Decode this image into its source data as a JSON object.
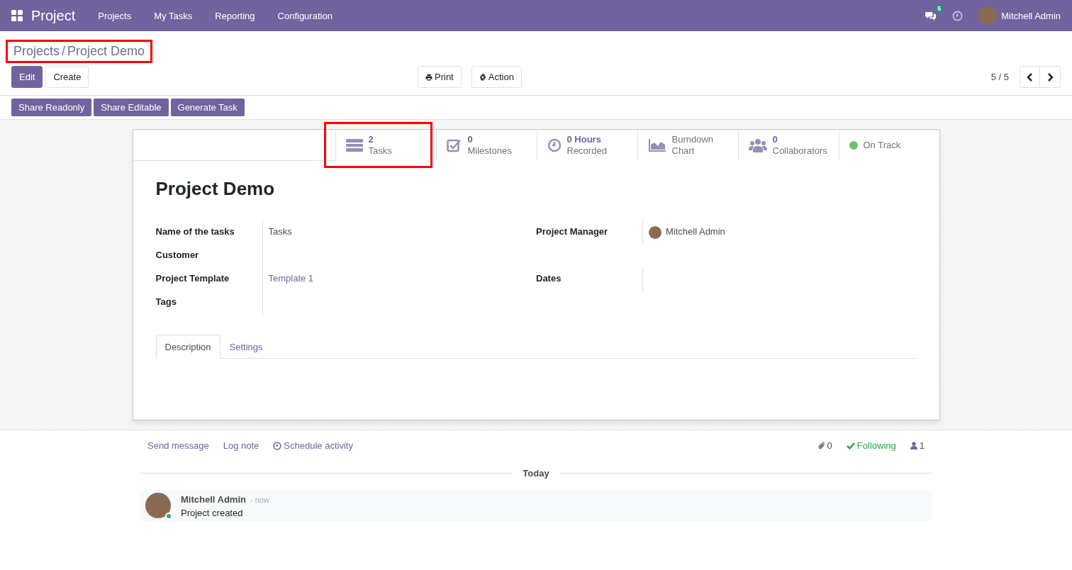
{
  "navbar": {
    "app_name": "Project",
    "menu": [
      "Projects",
      "My Tasks",
      "Reporting",
      "Configuration"
    ],
    "messages_count": "5",
    "user": "Mitchell Admin"
  },
  "breadcrumb": {
    "highlighted": true,
    "separator": "/",
    "items": [
      "Projects",
      "Project Demo"
    ]
  },
  "actions": [
    {
      "label": "Edit",
      "kind": "primary"
    },
    {
      "label": "Create",
      "kind": "secondary"
    }
  ],
  "middle_actions": [
    {
      "label": "Print",
      "kind": "print"
    },
    {
      "label": "Action",
      "kind": "gear"
    }
  ],
  "pager": {
    "text": "5 / 5"
  },
  "header_buttons": [
    "Share Readonly",
    "Share Editable",
    "Generate Task"
  ],
  "stat_buttons": [
    {
      "kind": "tasks",
      "value": "2",
      "label": "Tasks",
      "highlighted": true
    },
    {
      "kind": "milestones",
      "value": "0",
      "label": "Milestones",
      "highlighted": false
    },
    {
      "kind": "hours",
      "value": "0 Hours",
      "label": "Recorded",
      "highlighted": false
    },
    {
      "kind": "chart",
      "value": "Burndown",
      "label": "Chart",
      "highlighted": false
    },
    {
      "kind": "collaborators",
      "value": "0",
      "label": "Collaborators",
      "highlighted": false
    },
    {
      "kind": "status",
      "label": "On Track",
      "color": "#6cc070",
      "highlighted": false
    }
  ],
  "title": "Project Demo",
  "left_fields": [
    {
      "label": "Name of the tasks",
      "value": "Tasks",
      "kind": "text"
    },
    {
      "label": "Customer"
    },
    {
      "label": "Project Template",
      "value": "Template 1",
      "kind": "link"
    },
    {
      "label": "Tags"
    }
  ],
  "right_fields": [
    {
      "label": "Project Manager",
      "value": "Mitchell Admin",
      "kind": "user"
    },
    {
      "label": "Dates"
    }
  ],
  "tabs": [
    {
      "label": "Description",
      "selected": true
    },
    {
      "label": "Settings",
      "selected": false
    }
  ],
  "chatter": {
    "actions": [
      {
        "label": "Send message",
        "kind": "plain"
      },
      {
        "label": "Log note",
        "kind": "plain"
      },
      {
        "label": "Schedule activity",
        "kind": "clock"
      }
    ],
    "attachments": "0",
    "following": "Following",
    "followers": "1",
    "date_separator": "Today",
    "messages": [
      {
        "author": "Mitchell Admin",
        "time": "- now",
        "body": "Project created",
        "online": true
      }
    ]
  }
}
